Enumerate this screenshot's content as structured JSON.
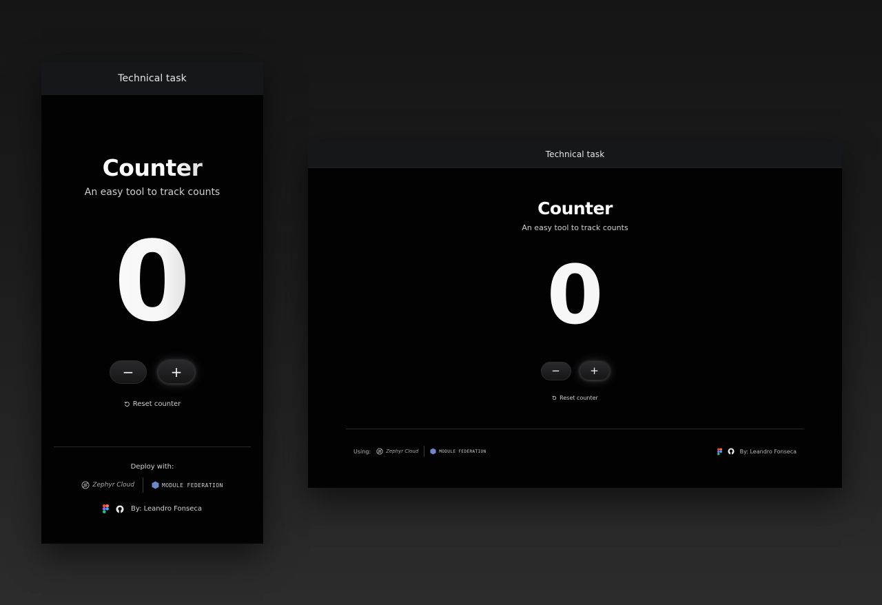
{
  "mobile": {
    "header_title": "Technical task",
    "title": "Counter",
    "subtitle": "An easy tool to track counts",
    "count": "0",
    "decrement_label": "−",
    "increment_label": "+",
    "reset_label": "Reset counter",
    "deploy_label": "Deploy with:",
    "zephyr_label": "Zephyr Cloud",
    "module_federation_label": "MODULE FEDERATION",
    "author": "By: Leandro Fonseca"
  },
  "desktop": {
    "header_title": "Technical task",
    "title": "Counter",
    "subtitle": "An easy tool to track counts",
    "count": "0",
    "decrement_label": "−",
    "increment_label": "+",
    "reset_label": "Reset counter",
    "using_label": "Using:",
    "zephyr_label": "Zephyr Cloud",
    "module_federation_label": "MODULE FEDERATION",
    "author": "By: Leandro Fonseca"
  },
  "icons": {
    "reset": "reset-icon",
    "zephyr": "zephyr-icon",
    "module_federation": "hexagon-icon",
    "figma": "figma-icon",
    "github": "github-icon"
  },
  "colors": {
    "background": "#1c1c1c",
    "panel": "#020203",
    "header": "#16171a",
    "module_federation_accent": "#6f86c9",
    "figma_red": "#f24e1e",
    "figma_orange": "#ff7262",
    "figma_purple": "#a259ff",
    "figma_blue": "#1abcfe",
    "figma_green": "#0acf83"
  }
}
